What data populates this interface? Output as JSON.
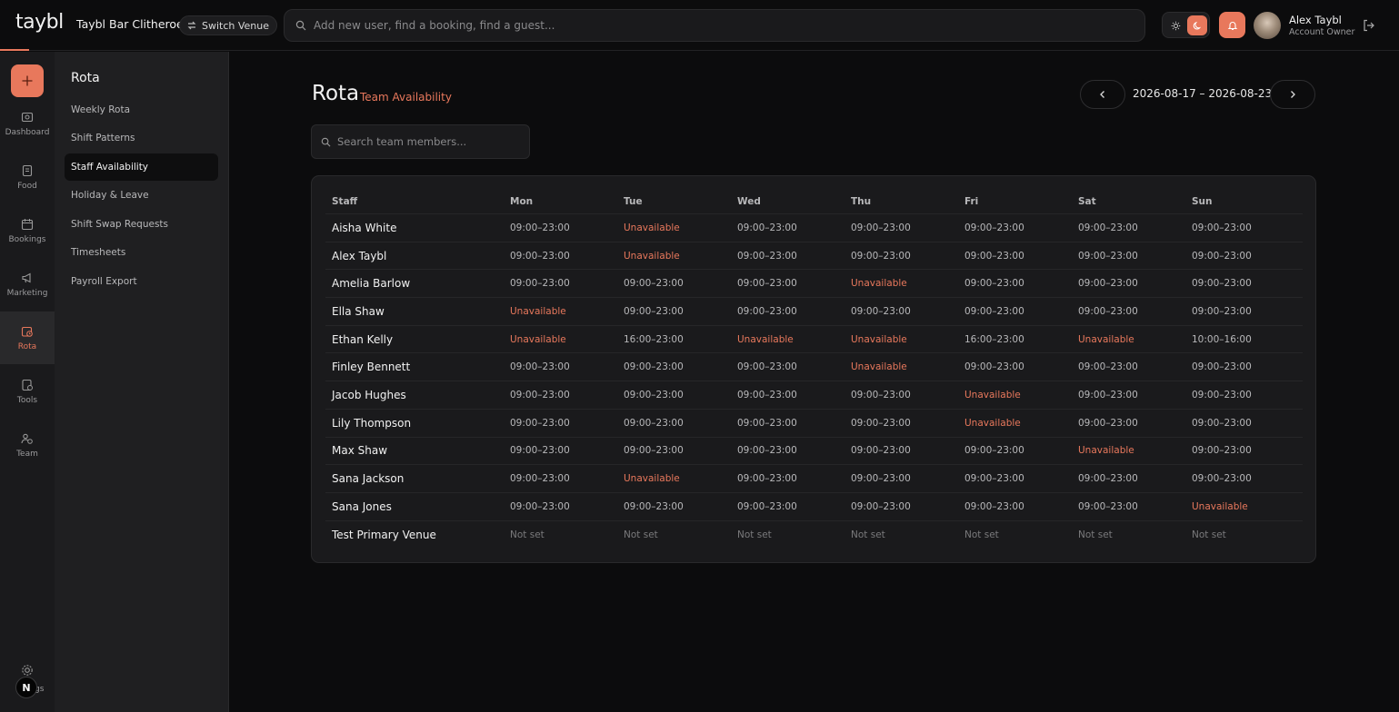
{
  "app": {
    "logo": "taybl",
    "venue_name": "Taybl Bar Clitheroe",
    "switch_venue_label": "Switch Venue",
    "search_placeholder": "Add new user, find a booking, find a guest...",
    "user": {
      "name": "Alex Taybl",
      "role": "Account Owner"
    },
    "accent_color": "#e8785c"
  },
  "rail": {
    "items": [
      {
        "label": "Dashboard",
        "icon": "dashboard-icon"
      },
      {
        "label": "Food",
        "icon": "food-icon"
      },
      {
        "label": "Bookings",
        "icon": "bookings-icon"
      },
      {
        "label": "Marketing",
        "icon": "megaphone-icon"
      },
      {
        "label": "Rota",
        "icon": "rota-icon",
        "active": true
      },
      {
        "label": "Tools",
        "icon": "tools-icon"
      },
      {
        "label": "Team",
        "icon": "team-icon"
      }
    ],
    "settings_label": "gs",
    "n_badge": "N"
  },
  "submenu": {
    "title": "Rota",
    "items": [
      {
        "label": "Weekly Rota"
      },
      {
        "label": "Shift Patterns"
      },
      {
        "label": "Staff Availability",
        "active": true
      },
      {
        "label": "Holiday & Leave"
      },
      {
        "label": "Shift Swap Requests"
      },
      {
        "label": "Timesheets"
      },
      {
        "label": "Payroll Export"
      }
    ]
  },
  "page": {
    "title": "Rota",
    "subtitle": "Team Availability",
    "date_range": "2026-08-17 – 2026-08-23",
    "member_search_placeholder": "Search team members..."
  },
  "table": {
    "headers": [
      "Staff",
      "Mon",
      "Tue",
      "Wed",
      "Thu",
      "Fri",
      "Sat",
      "Sun"
    ],
    "rows": [
      {
        "staff": "Aisha White",
        "days": [
          "09:00–23:00",
          "Unavailable",
          "09:00–23:00",
          "09:00–23:00",
          "09:00–23:00",
          "09:00–23:00",
          "09:00–23:00"
        ]
      },
      {
        "staff": "Alex Taybl",
        "days": [
          "09:00–23:00",
          "Unavailable",
          "09:00–23:00",
          "09:00–23:00",
          "09:00–23:00",
          "09:00–23:00",
          "09:00–23:00"
        ]
      },
      {
        "staff": "Amelia Barlow",
        "days": [
          "09:00–23:00",
          "09:00–23:00",
          "09:00–23:00",
          "Unavailable",
          "09:00–23:00",
          "09:00–23:00",
          "09:00–23:00"
        ]
      },
      {
        "staff": "Ella Shaw",
        "days": [
          "Unavailable",
          "09:00–23:00",
          "09:00–23:00",
          "09:00–23:00",
          "09:00–23:00",
          "09:00–23:00",
          "09:00–23:00"
        ]
      },
      {
        "staff": "Ethan Kelly",
        "days": [
          "Unavailable",
          "16:00–23:00",
          "Unavailable",
          "Unavailable",
          "16:00–23:00",
          "Unavailable",
          "10:00–16:00"
        ]
      },
      {
        "staff": "Finley Bennett",
        "days": [
          "09:00–23:00",
          "09:00–23:00",
          "09:00–23:00",
          "Unavailable",
          "09:00–23:00",
          "09:00–23:00",
          "09:00–23:00"
        ]
      },
      {
        "staff": "Jacob Hughes",
        "days": [
          "09:00–23:00",
          "09:00–23:00",
          "09:00–23:00",
          "09:00–23:00",
          "Unavailable",
          "09:00–23:00",
          "09:00–23:00"
        ]
      },
      {
        "staff": "Lily Thompson",
        "days": [
          "09:00–23:00",
          "09:00–23:00",
          "09:00–23:00",
          "09:00–23:00",
          "Unavailable",
          "09:00–23:00",
          "09:00–23:00"
        ]
      },
      {
        "staff": "Max Shaw",
        "days": [
          "09:00–23:00",
          "09:00–23:00",
          "09:00–23:00",
          "09:00–23:00",
          "09:00–23:00",
          "Unavailable",
          "09:00–23:00"
        ]
      },
      {
        "staff": "Sana Jackson",
        "days": [
          "09:00–23:00",
          "Unavailable",
          "09:00–23:00",
          "09:00–23:00",
          "09:00–23:00",
          "09:00–23:00",
          "09:00–23:00"
        ]
      },
      {
        "staff": "Sana Jones",
        "days": [
          "09:00–23:00",
          "09:00–23:00",
          "09:00–23:00",
          "09:00–23:00",
          "09:00–23:00",
          "09:00–23:00",
          "Unavailable"
        ]
      },
      {
        "staff": "Test Primary Venue",
        "days": [
          "Not set",
          "Not set",
          "Not set",
          "Not set",
          "Not set",
          "Not set",
          "Not set"
        ]
      }
    ]
  }
}
